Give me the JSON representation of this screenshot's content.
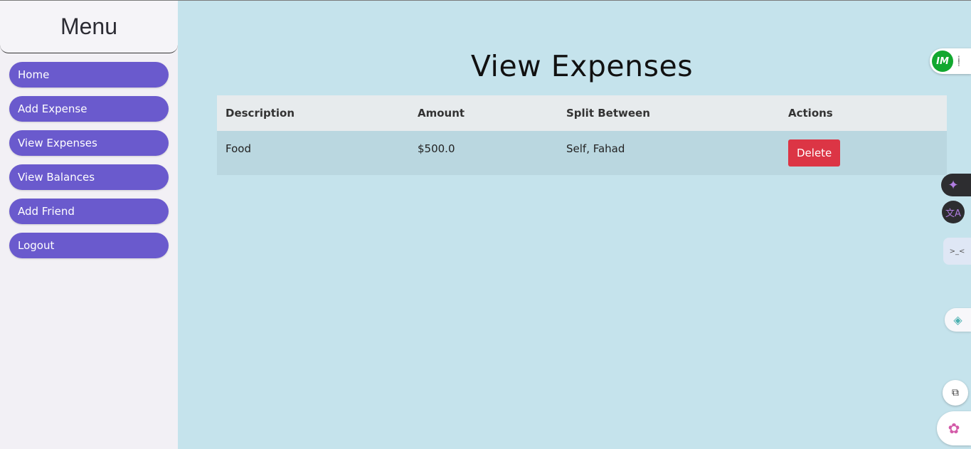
{
  "sidebar": {
    "title": "Menu",
    "items": [
      {
        "label": "Home"
      },
      {
        "label": "Add Expense"
      },
      {
        "label": "View Expenses"
      },
      {
        "label": "View Balances"
      },
      {
        "label": "Add Friend"
      },
      {
        "label": "Logout"
      }
    ]
  },
  "main": {
    "title": "View Expenses",
    "table": {
      "headers": [
        "Description",
        "Amount",
        "Split Between",
        "Actions"
      ],
      "rows": [
        {
          "description": "Food",
          "amount": "$500.0",
          "split": "Self, Fahad",
          "action_label": "Delete"
        }
      ]
    }
  },
  "widgets": {
    "im_logo_text": "IM",
    "icons": [
      "im-extension-icon",
      "sparkle-icon",
      "translate-icon",
      "code-panel-icon",
      "layers-icon",
      "translate-page-icon",
      "brain-icon"
    ]
  },
  "colors": {
    "background": "#c5e3ec",
    "sidebar": "#f2f0f5",
    "menu_button": "#6a5acd",
    "delete_button": "#dc3545",
    "table_header": "#e7ebed",
    "table_row": "#bad7e0"
  }
}
